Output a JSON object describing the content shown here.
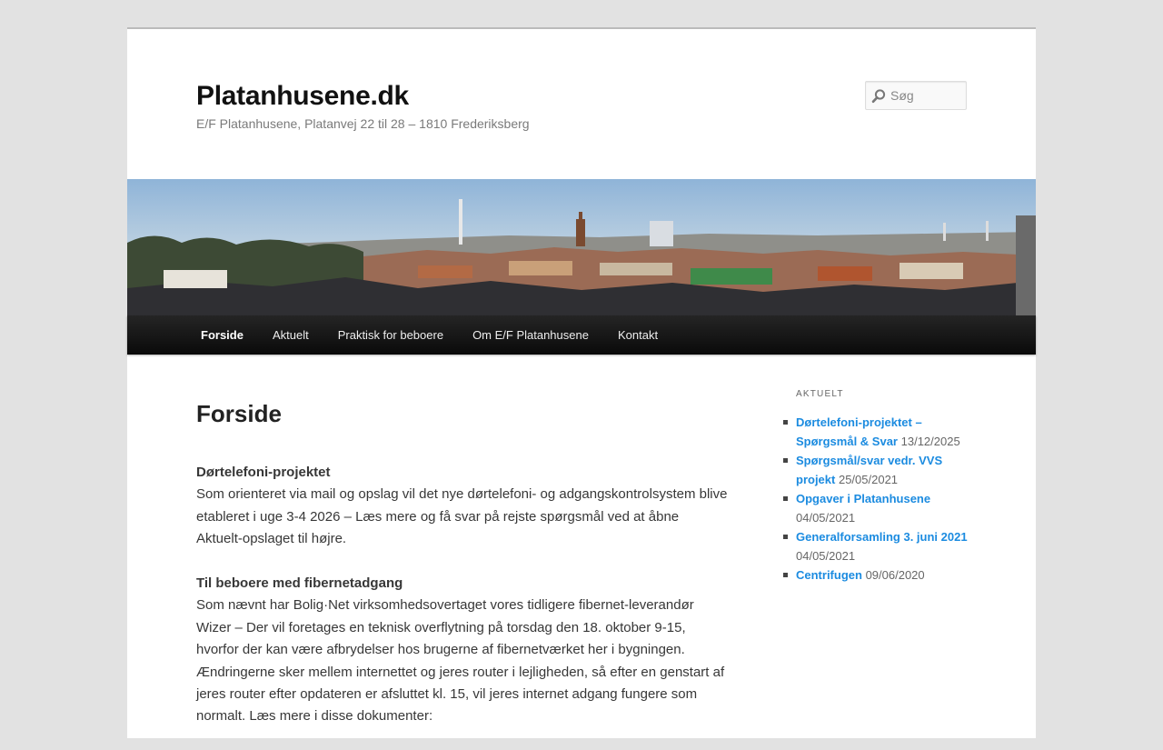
{
  "header": {
    "site_title": "Platanhusene.dk",
    "site_description": "E/F Platanhusene, Platanvej 22 til 28 – 1810 Frederiksberg",
    "search_placeholder": "Søg"
  },
  "nav": {
    "items": [
      "Forside",
      "Aktuelt",
      "Praktisk for beboere",
      "Om E/F Platanhusene",
      "Kontakt"
    ],
    "current": "Forside"
  },
  "main": {
    "page_title": "Forside",
    "sections": [
      {
        "heading": "Dørtelefoni-projektet",
        "body": "Som orienteret via mail og opslag vil det nye dørtelefoni- og adgangskontrolsystem blive etableret i uge 3-4 2026 – Læs mere og få svar på rejste spørgsmål ved at åbne Aktuelt-opslaget til højre."
      },
      {
        "heading": "Til beboere med fibernetadgang",
        "body": "Som nævnt har Bolig·Net virksomhedsovertaget vores tidligere fibernet-leverandør Wizer – Der vil foretages en teknisk overflytning på torsdag den 18. oktober 9-15, hvorfor der kan være afbrydelser hos brugerne af fibernetværket her i bygningen. Ændringerne sker mellem internettet og jeres router i lejligheden, så efter en genstart af jeres router efter opdateren er afsluttet kl. 15, vil jeres internet adgang fungere som normalt. Læs mere i disse dokumenter:"
      }
    ]
  },
  "sidebar": {
    "widget_title": "AKTUELT",
    "posts": [
      {
        "title": "Dørtelefoni-projektet – Spørgsmål & Svar",
        "date": "13/12/2025"
      },
      {
        "title": "Spørgsmål/svar vedr. VVS projekt",
        "date": "25/05/2021"
      },
      {
        "title": "Opgaver i Platanhusene",
        "date": "04/05/2021"
      },
      {
        "title": "Generalforsamling 3. juni 2021",
        "date": "04/05/2021"
      },
      {
        "title": "Centrifugen",
        "date": "09/06/2020"
      }
    ]
  },
  "colors": {
    "background": "#e2e2e2",
    "link": "#1b8be0",
    "nav_bg": "#111111"
  }
}
